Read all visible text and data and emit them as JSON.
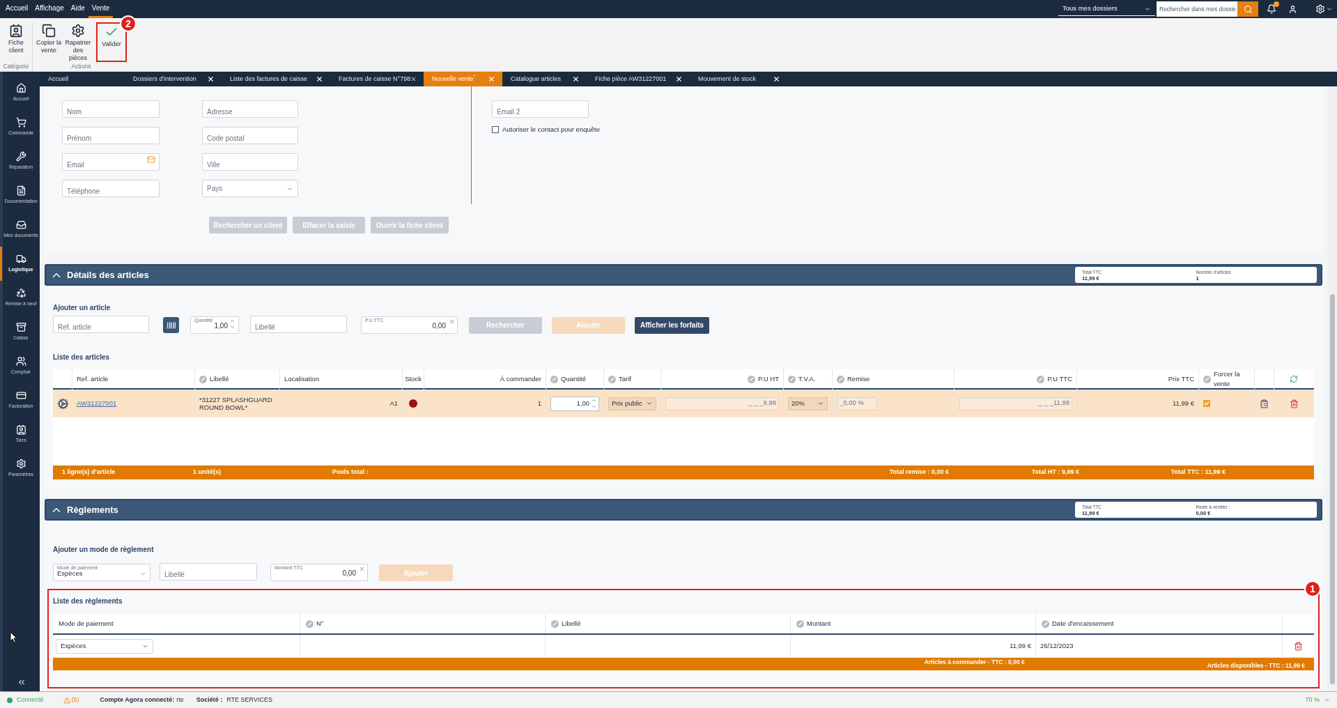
{
  "menu": [
    {
      "label": "Accueil",
      "selected": false
    },
    {
      "label": "Affichage",
      "selected": false
    },
    {
      "label": "Aide",
      "selected": false
    },
    {
      "label": "Vente",
      "selected": true
    }
  ],
  "topbar": {
    "folder_select": "Tous mes dossiers",
    "search_placeholder": "Rechercher dans mes dossie"
  },
  "ribbon": [
    {
      "label": "Catégorie",
      "buttons": [
        {
          "label": "Fiche client"
        }
      ]
    },
    {
      "label": "Actions",
      "buttons": [
        {
          "label": "Copier la vente"
        },
        {
          "label": "Rapatrier des pièces"
        },
        {
          "label": "Valider",
          "callout": "2"
        }
      ]
    }
  ],
  "sidebar": [
    {
      "label": "Accueil",
      "selected": false
    },
    {
      "label": "Commande",
      "selected": false
    },
    {
      "label": "Réparation",
      "selected": false
    },
    {
      "label": "Documentation",
      "selected": false
    },
    {
      "label": "Mes documents",
      "selected": false
    },
    {
      "label": "Logistique",
      "selected": true
    },
    {
      "label": "Remise à neuf",
      "selected": false
    },
    {
      "label": "Caisse",
      "selected": false
    },
    {
      "label": "Comptoir",
      "selected": false
    },
    {
      "label": "Facturation",
      "selected": false
    },
    {
      "label": "Tiers",
      "selected": false
    },
    {
      "label": "Paramètres",
      "selected": false
    }
  ],
  "tabs": [
    {
      "label": "Accueil",
      "selected": false,
      "closable": false
    },
    {
      "label": "Dossiers d'intervention",
      "selected": false,
      "closable": true
    },
    {
      "label": "Liste des factures de caisse",
      "selected": false,
      "closable": true
    },
    {
      "label": "Factures de caisse N°798",
      "selected": false,
      "closable": true
    },
    {
      "label": "Nouvelle vente$^{*}$",
      "selected": true,
      "closable": true
    },
    {
      "label": "Catalogue articles",
      "selected": false,
      "closable": true
    },
    {
      "label": "Fiche pièce AW31227001",
      "selected": false,
      "closable": true
    },
    {
      "label": "Mouvement de stock",
      "selected": false,
      "closable": true
    }
  ],
  "customer_form": {
    "columns": [
      [
        {
          "placeholder": "Nom",
          "kind": "text"
        },
        {
          "placeholder": "Prénom",
          "kind": "text"
        },
        {
          "placeholder": "Email",
          "kind": "email"
        },
        {
          "placeholder": "Téléphone",
          "kind": "text"
        }
      ],
      [
        {
          "placeholder": "Adresse",
          "kind": "text"
        },
        {
          "placeholder": "Code postal",
          "kind": "text"
        },
        {
          "placeholder": "Ville",
          "kind": "text"
        },
        {
          "placeholder": "Pays",
          "kind": "select"
        }
      ]
    ],
    "contact": [
      {
        "placeholder": "Email 2",
        "kind": "text"
      }
    ],
    "consent": {
      "label": "Autoriser le contact pour enquête",
      "checked": false
    },
    "buttons": [
      {
        "label": "Rechercher un client",
        "disabled": true
      },
      {
        "label": "Effacer la saisie",
        "disabled": true
      },
      {
        "label": "Ouvrir la fiche client",
        "disabled": true
      }
    ]
  },
  "articles": {
    "title": "Détails des articles",
    "expanded": true,
    "summary": [
      {
        "label": "Total TTC",
        "value": "11,99 €"
      },
      {
        "label": "Nombre d'articles",
        "value": "1"
      }
    ],
    "add_title": "Ajouter un article",
    "ref": {
      "placeholder": "Ref. article"
    },
    "quantity": {
      "label": "Quantité",
      "value": "1,00"
    },
    "label_field": {
      "placeholder": "Libellé"
    },
    "unit_price": {
      "label": "P.U TTC",
      "value": "0,00"
    },
    "buttons": [
      {
        "label": "Rechercher",
        "kind": "neutral",
        "disabled": true
      },
      {
        "label": "Ajouter",
        "kind": "accent",
        "disabled": true
      },
      {
        "label": "Afficher les forfaits",
        "kind": "primary",
        "disabled": false
      }
    ],
    "list_title": "Liste des articles",
    "columns": [
      {
        "label": "Ref. article",
        "editable": false
      },
      {
        "label": "Libellé",
        "editable": true
      },
      {
        "label": "Localisation",
        "editable": false
      },
      {
        "label": "Stock",
        "editable": false
      },
      {
        "label": "À commander",
        "editable": false
      },
      {
        "label": "Quantité",
        "editable": true
      },
      {
        "label": "Tarif",
        "editable": true
      },
      {
        "label": "P.U HT",
        "editable": true
      },
      {
        "label": "T.V.A.",
        "editable": true
      },
      {
        "label": "Remise",
        "editable": true
      },
      {
        "label": "P.U TTC",
        "editable": true
      },
      {
        "label": "Prix TTC",
        "editable": false
      },
      {
        "label": "Forcer la vente",
        "editable": true
      }
    ],
    "rows": [
      {
        "selected": true,
        "ref": "AW31227001",
        "label": "*31227 SPLASHGUARD ROUND BOWL*",
        "location": "A1",
        "color": "#9b1010",
        "to_order": "1",
        "quantity": "1,00",
        "tariff": "Prix public",
        "unit_price_ht": "_ _ _9,99",
        "vat": "20%",
        "discount": "_0,00 %",
        "unit_price_ttc": "_ _ _11,99",
        "total_ttc": "11,99 €",
        "forced": true
      }
    ],
    "footer": [
      "1 ligne(s) d'article",
      "1 unité(s)",
      "Poids total :",
      "Total remise : 0,00 €",
      "Total HT : 9,99 €",
      "Total TTC : 11,99 €"
    ]
  },
  "payments": {
    "title": "Règlements",
    "expanded": true,
    "summary": [
      {
        "label": "Total TTC",
        "value": "11,99 €"
      },
      {
        "label": "Reste à ventiler :",
        "value": "0,00 €"
      }
    ],
    "add_title": "Ajouter un mode de règlement",
    "mode": {
      "label": "Mode de paiement",
      "value": "Espèces"
    },
    "label_field": {
      "placeholder": "Libellé"
    },
    "amount": {
      "label": "Montant TTC",
      "value": "0,00"
    },
    "button": {
      "label": "Ajouter",
      "kind": "accent",
      "disabled": true
    },
    "list_title": "Liste des règlements",
    "callout": "1",
    "columns": [
      {
        "label": "Mode de paiement",
        "editable": false
      },
      {
        "label": "N°",
        "editable": true
      },
      {
        "label": "Libellé",
        "editable": true
      },
      {
        "label": "Montant",
        "editable": true
      },
      {
        "label": "Date d'encaissement",
        "editable": true
      }
    ],
    "rows": [
      {
        "mode": "Espèces",
        "amount": "11,99 €",
        "date": "26/12/2023"
      }
    ],
    "footer": [
      "Articles à commander - TTC : 0,00 €",
      "Articles disponibles - TTC : 11,99 €"
    ]
  },
  "status": {
    "connection": {
      "label": "Connecté",
      "connected": true
    },
    "warnings": "(5)",
    "account": {
      "label": "Compte Agora connecté:",
      "value": "rte"
    },
    "company": {
      "label": "Société :",
      "value": "RTE SERVICES"
    },
    "zoom": "70 %"
  }
}
